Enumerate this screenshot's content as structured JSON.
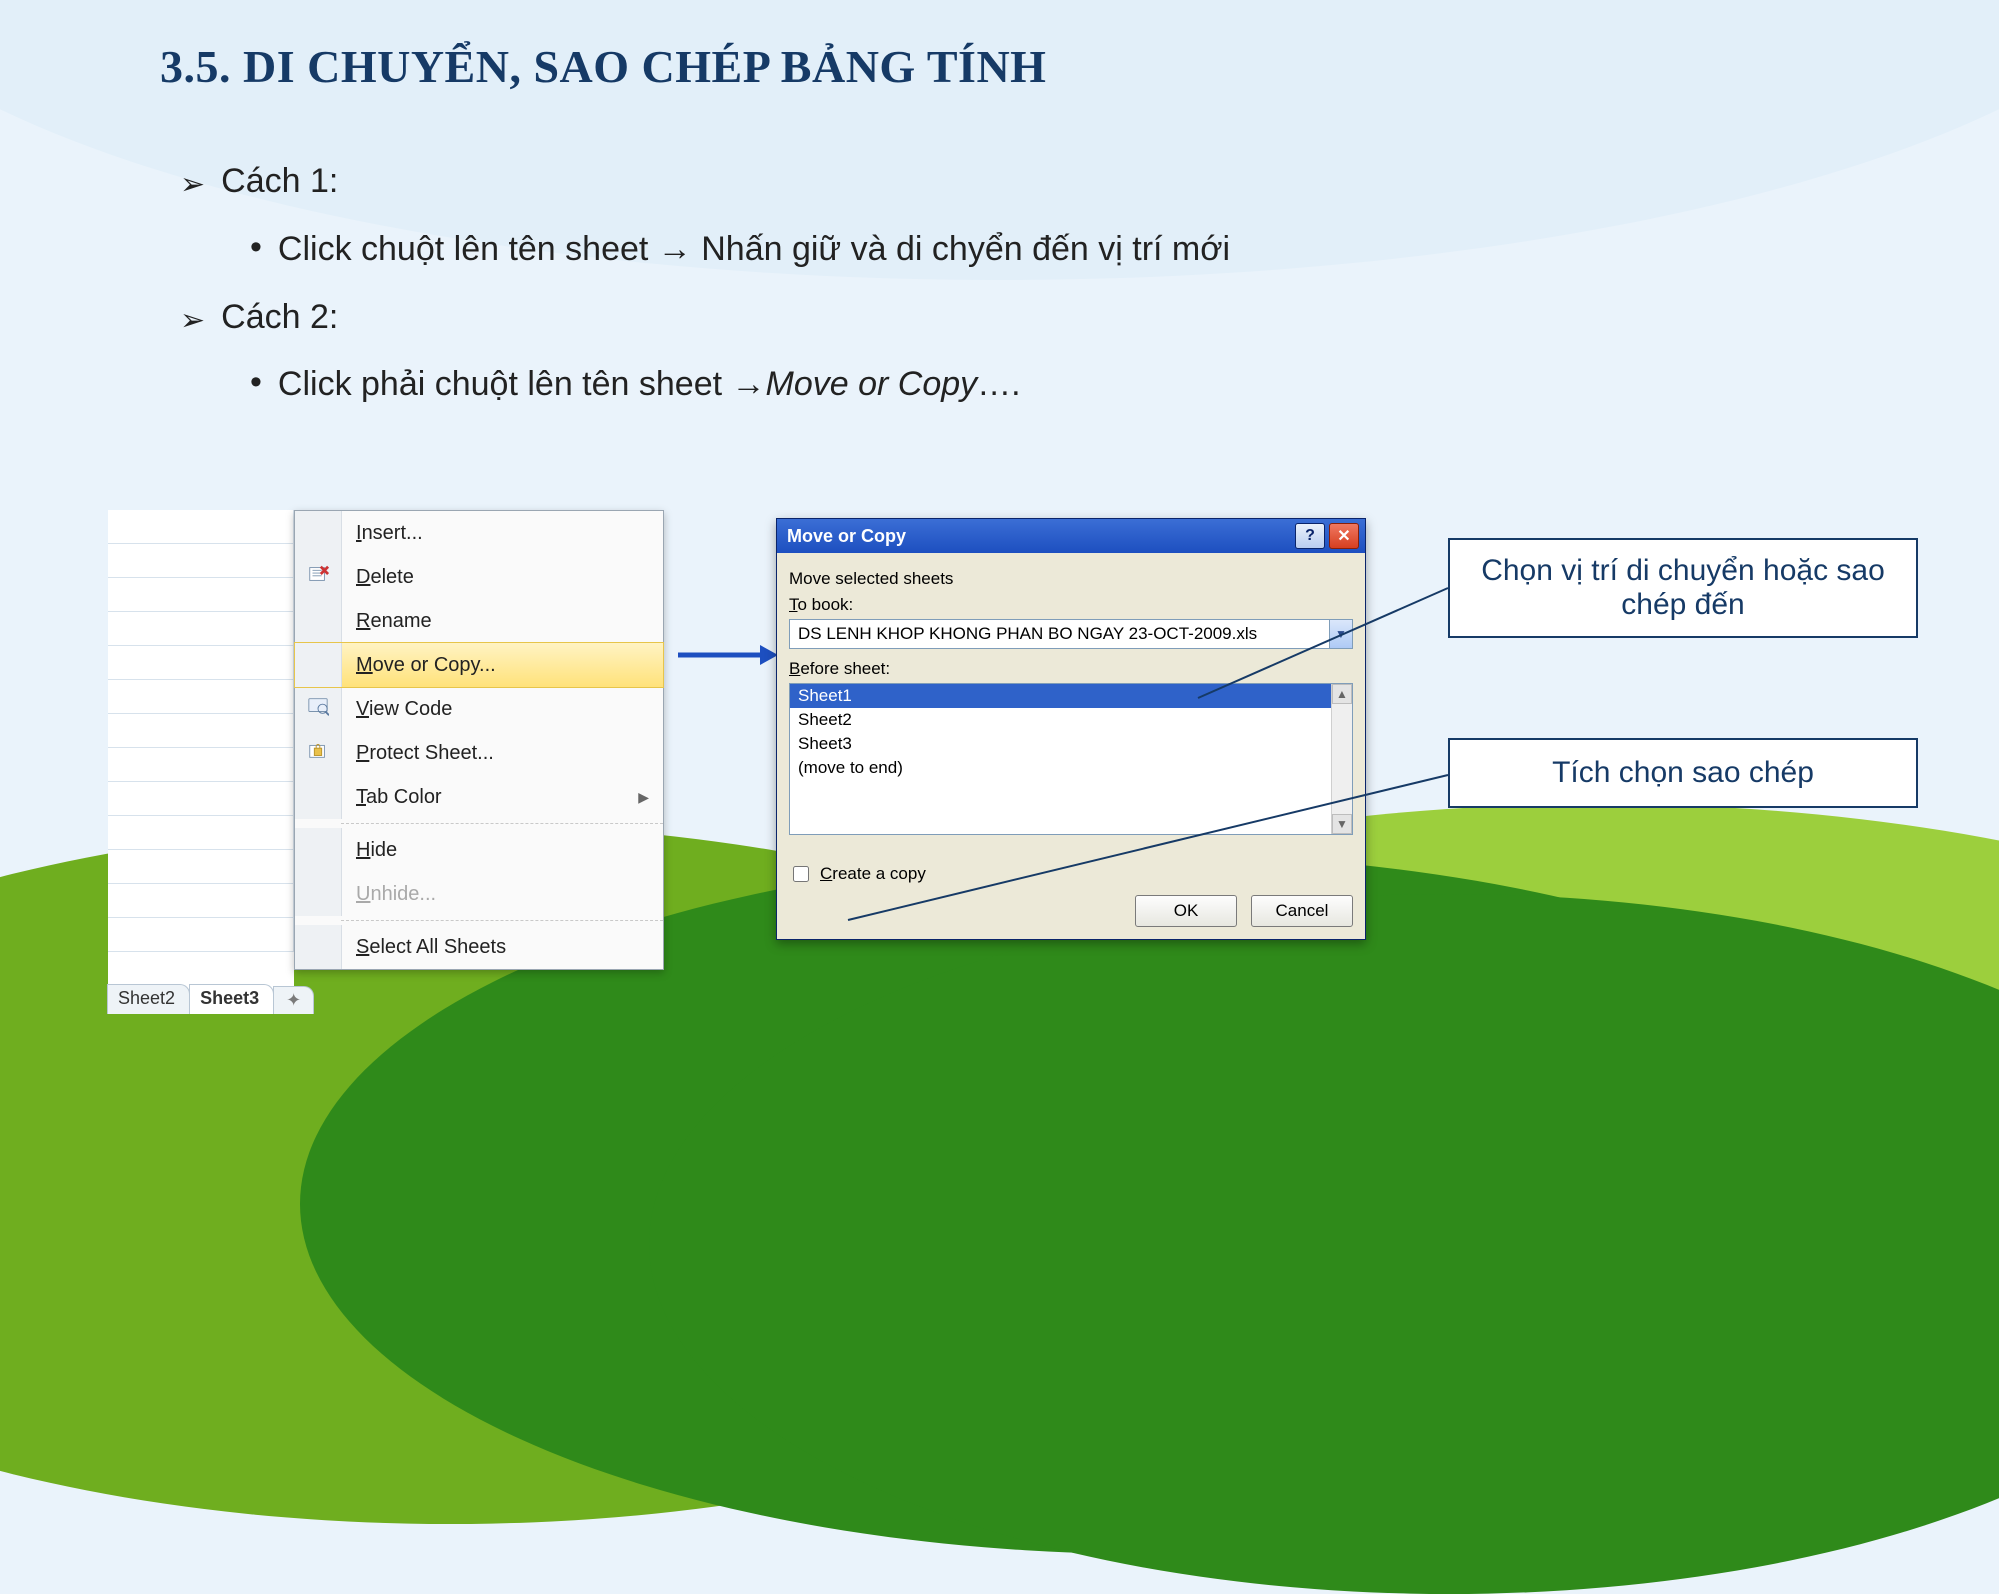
{
  "title": "3.5. DI CHUYỂN, SAO CHÉP BẢNG TÍNH",
  "b1": "Cách 1:",
  "b1a_pre": "Click chuột lên tên sheet ",
  "b1a_post": " Nhấn giữ và di chyển đến vị trí mới",
  "b2": "Cách 2:",
  "b2a_pre": "Click phải chuột lên tên sheet ",
  "b2a_em": "Move or Copy",
  "b2a_post": "….",
  "arrow_glyph": "→",
  "sheet_tabs": {
    "t1": "Sheet2",
    "t2": "Sheet3"
  },
  "menu": {
    "insert": "Insert...",
    "delete": "Delete",
    "rename": "Rename",
    "move": "Move or Copy...",
    "view": "View Code",
    "protect": "Protect Sheet...",
    "tabcolor": "Tab Color",
    "hide": "Hide",
    "unhide": "Unhide...",
    "selectall": "Select All Sheets"
  },
  "dlg": {
    "title": "Move or Copy",
    "l1": "Move selected sheets",
    "l2": "To book:",
    "book": "DS LENH KHOP KHONG PHAN BO NGAY 23-OCT-2009.xls",
    "l3": "Before sheet:",
    "items": {
      "i1": "Sheet1",
      "i2": "Sheet2",
      "i3": "Sheet3",
      "i4": "(move to end)"
    },
    "chk": "Create a copy",
    "ok": "OK",
    "cancel": "Cancel"
  },
  "callout1": "Chọn vị trí di chuyển hoặc sao chép đến",
  "callout2": "Tích chọn sao chép"
}
